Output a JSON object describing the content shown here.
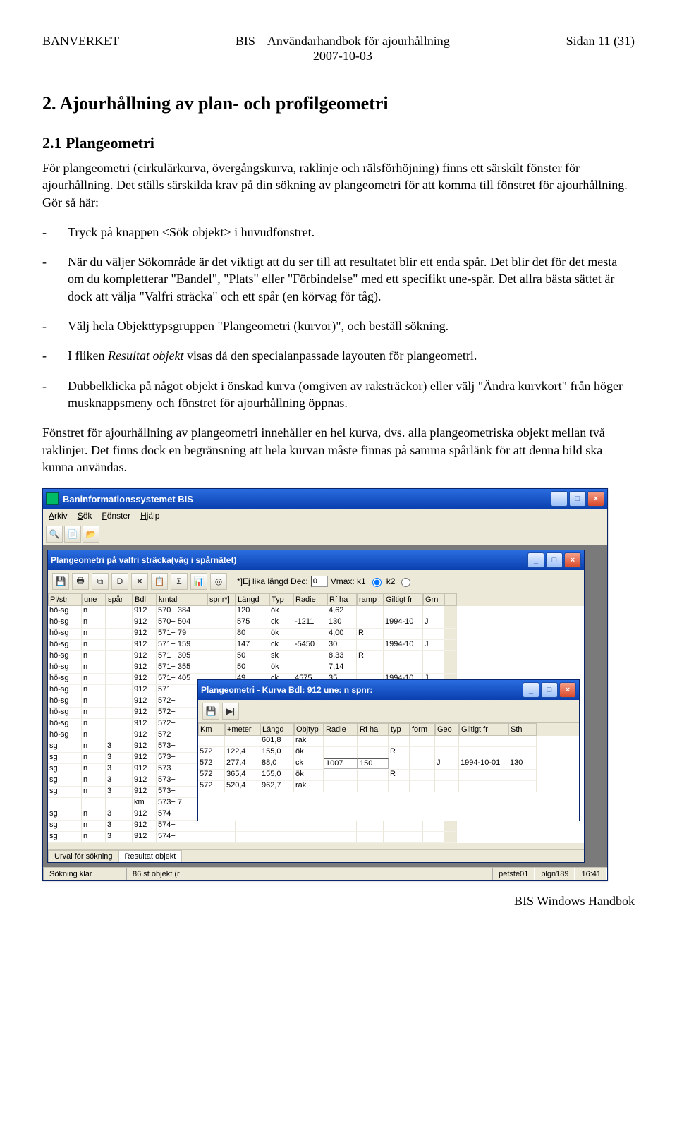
{
  "header": {
    "left": "BANVERKET",
    "centerTitle": "BIS – Användarhandbok för ajourhållning",
    "centerDate": "2007-10-03",
    "right": "Sidan 11 (31)"
  },
  "h1": "2. Ajourhållning av plan- och profilgeometri",
  "h2": "2.1 Plangeometri",
  "p1": "För plangeometri (cirkulärkurva, övergångskurva, raklinje och rälsförhöjning) finns ett särskilt fönster för ajourhållning. Det ställs särskilda krav på din sökning av plangeometri för att komma till fönstret för ajourhållning. Gör så här:",
  "b1": "Tryck på knappen <Sök objekt> i huvudfönstret.",
  "b2": "När du väljer Sökområde är det viktigt att du ser till att resultatet blir ett enda spår. Det blir det för det mesta om du kompletterar \"Bandel\", \"Plats\" eller \"Förbindelse\" med ett specifikt une-spår. Det allra bästa sättet är dock att välja \"Valfri sträcka\" och ett spår (en körväg för tåg).",
  "b3": "Välj hela Objekttypsgruppen \"Plangeometri (kurvor)\", och beställ sökning.",
  "b4": "I fliken Resultat objekt visas då den specialanpassade layouten för plangeometri.",
  "b5": "Dubbelklicka på något objekt i önskad kurva (omgiven av raksträckor) eller välj \"Ändra kurvkort\" från höger musknappsmeny och fönstret för ajourhållning öppnas.",
  "p2": "Fönstret för ajourhållning av plangeometri innehåller en hel kurva, dvs. alla plangeometriska objekt mellan två raklinjer. Det finns dock en begränsning att hela kurvan måste finnas på samma spårlänk för att denna bild ska kunna användas.",
  "footer": "BIS Windows Handbok",
  "bullet": {
    "italics": "Resultat objekt"
  },
  "app": {
    "title": "Baninformationssystemet BIS",
    "menus": [
      "Arkiv",
      "Sök",
      "Fönster",
      "Hjälp"
    ],
    "child1Title": "Plangeometri på valfri sträcka(väg i spårnätet)",
    "child1ToolText": "*]Ej lika längd  Dec:",
    "child1Dec": "0",
    "child1Vmax": " Vmax: k1",
    "k2": " k2",
    "gridHeaders": [
      "Pl/str",
      "une",
      "spår",
      "Bdl",
      "kmtal",
      "spnr*]",
      "Längd",
      "Typ",
      "Radie",
      "Rf ha",
      "ramp",
      "Giltigt fr",
      "Grn",
      ""
    ],
    "rows": [
      [
        "hö-sg",
        "n",
        "",
        "912",
        "570+ 384",
        "",
        "120",
        "ök",
        "",
        "4,62",
        "",
        "",
        "",
        ""
      ],
      [
        "hö-sg",
        "n",
        "",
        "912",
        "570+ 504",
        "",
        "575",
        "ck",
        "-1211",
        "130",
        "",
        "1994-10",
        "J",
        ""
      ],
      [
        "hö-sg",
        "n",
        "",
        "912",
        "571+ 79",
        "",
        "80",
        "ök",
        "",
        "4,00",
        "R",
        "",
        "",
        ""
      ],
      [
        "hö-sg",
        "n",
        "",
        "912",
        "571+ 159",
        "",
        "147",
        "ck",
        "-5450",
        "30",
        "",
        "1994-10",
        "J",
        ""
      ],
      [
        "hö-sg",
        "n",
        "",
        "912",
        "571+ 305",
        "",
        "50",
        "sk",
        "",
        "8,33",
        "R",
        "",
        "",
        ""
      ],
      [
        "hö-sg",
        "n",
        "",
        "912",
        "571+ 355",
        "",
        "50",
        "ök",
        "",
        "7,14",
        "",
        "",
        "",
        ""
      ],
      [
        "hö-sg",
        "n",
        "",
        "912",
        "571+ 405",
        "",
        "49",
        "ck",
        "4575",
        "35",
        "",
        "1994-10",
        "J",
        ""
      ],
      [
        "hö-sg",
        "n",
        "",
        "912",
        "571+",
        "",
        "",
        "",
        "",
        "",
        "",
        "",
        "",
        ""
      ],
      [
        "hö-sg",
        "n",
        "",
        "912",
        "572+",
        "",
        "",
        "",
        "",
        "",
        "",
        "",
        "",
        ""
      ],
      [
        "hö-sg",
        "n",
        "",
        "912",
        "572+",
        "",
        "",
        "",
        "",
        "",
        "",
        "",
        "",
        ""
      ],
      [
        "hö-sg",
        "n",
        "",
        "912",
        "572+",
        "",
        "",
        "",
        "",
        "",
        "",
        "",
        "",
        ""
      ],
      [
        "hö-sg",
        "n",
        "",
        "912",
        "572+",
        "",
        "",
        "",
        "",
        "",
        "",
        "",
        "",
        ""
      ],
      [
        "sg",
        "n",
        "3",
        "912",
        "573+",
        "",
        "",
        "",
        "",
        "",
        "",
        "",
        "",
        ""
      ],
      [
        "sg",
        "n",
        "3",
        "912",
        "573+",
        "",
        "",
        "",
        "",
        "",
        "",
        "",
        "",
        ""
      ],
      [
        "sg",
        "n",
        "3",
        "912",
        "573+",
        "",
        "",
        "",
        "",
        "",
        "",
        "",
        "",
        ""
      ],
      [
        "sg",
        "n",
        "3",
        "912",
        "573+",
        "",
        "",
        "",
        "",
        "",
        "",
        "",
        "",
        ""
      ],
      [
        "sg",
        "n",
        "3",
        "912",
        "573+",
        "",
        "",
        "",
        "",
        "",
        "",
        "",
        "",
        ""
      ],
      [
        "",
        "",
        "",
        "km",
        "573+ 7",
        "",
        "",
        "",
        "",
        "",
        "",
        "",
        "",
        ""
      ],
      [
        "sg",
        "n",
        "3",
        "912",
        "574+",
        "",
        "",
        "",
        "",
        "",
        "",
        "",
        "",
        ""
      ],
      [
        "sg",
        "n",
        "3",
        "912",
        "574+",
        "",
        "",
        "",
        "",
        "",
        "",
        "",
        "",
        ""
      ],
      [
        "sg",
        "n",
        "3",
        "912",
        "574+",
        "",
        "",
        "",
        "",
        "",
        "",
        "",
        "",
        ""
      ]
    ],
    "child2Title": "Plangeometri - Kurva Bdl: 912  une: n  spnr:",
    "c2Headers": [
      "Km",
      "+meter",
      "Längd",
      "Objtyp",
      "Radie",
      "Rf ha",
      "typ",
      "form",
      "Geo",
      "Giltigt fr",
      "Sth"
    ],
    "c2rows": [
      [
        "",
        "",
        "601,8",
        "rak",
        "",
        "",
        "",
        "",
        "",
        "",
        ""
      ],
      [
        "572",
        "122,4",
        "155,0",
        "ök",
        "",
        "",
        "R",
        "",
        "",
        "",
        ""
      ],
      [
        "572",
        "277,4",
        "88,0",
        "ck",
        "1007",
        "150",
        "",
        "",
        "J",
        "1994-10-01",
        "130"
      ],
      [
        "572",
        "365,4",
        "155,0",
        "ök",
        "",
        "",
        "R",
        "",
        "",
        "",
        ""
      ],
      [
        "572",
        "520,4",
        "962,7",
        "rak",
        "",
        "",
        "",
        "",
        "",
        "",
        ""
      ]
    ],
    "tabs": [
      "Urval för sökning",
      "Resultat objekt"
    ],
    "statusLeft": "Sökning klar",
    "statusCount": "86 st objekt (r",
    "statusUser": "petste01",
    "statusMachine": "blgn189",
    "statusTime": "16:41"
  }
}
